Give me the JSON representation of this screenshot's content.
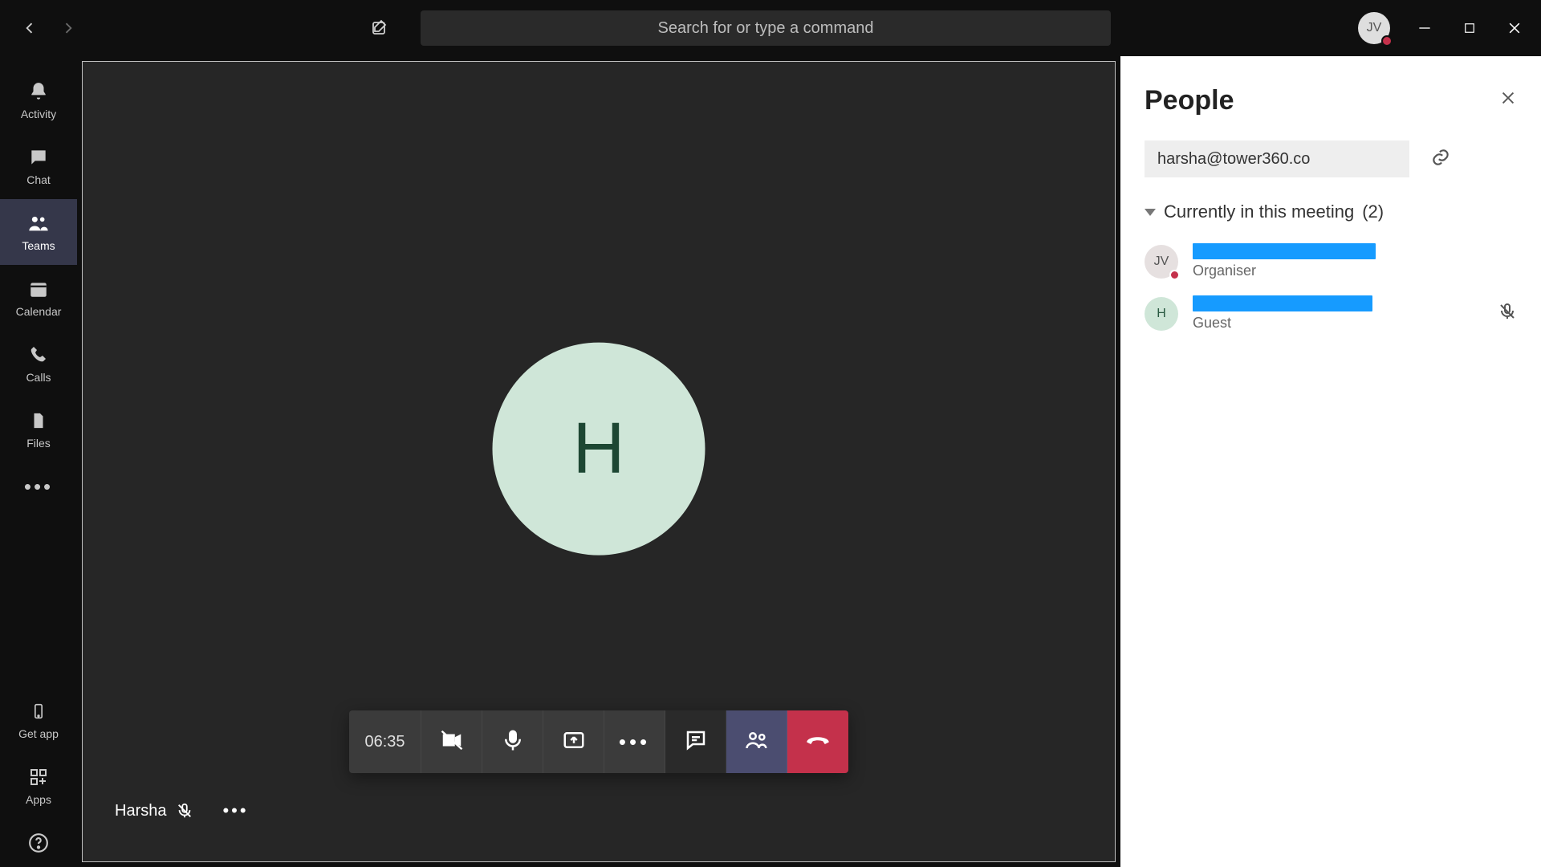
{
  "titlebar": {
    "search_placeholder": "Search for or type a command",
    "avatar_initials": "JV"
  },
  "rail": {
    "items": [
      {
        "id": "activity",
        "label": "Activity"
      },
      {
        "id": "chat",
        "label": "Chat"
      },
      {
        "id": "teams",
        "label": "Teams",
        "active": true
      },
      {
        "id": "calendar",
        "label": "Calendar"
      },
      {
        "id": "calls",
        "label": "Calls"
      },
      {
        "id": "files",
        "label": "Files"
      }
    ],
    "getapp_label": "Get app",
    "apps_label": "Apps"
  },
  "stage": {
    "big_avatar_initial": "H",
    "participant_name": "Harsha"
  },
  "callbar": {
    "timer": "06:35"
  },
  "people": {
    "title": "People",
    "invite_value": "harsha@tower360.co",
    "section_label": "Currently in this meeting",
    "section_count": "(2)",
    "participants": [
      {
        "avatar": "JV",
        "avatar_class": "jv",
        "redact_w": 228,
        "role": "Organiser",
        "presence": true,
        "muted": false
      },
      {
        "avatar": "H",
        "avatar_class": "h",
        "redact_w": 224,
        "role": "Guest",
        "presence": false,
        "muted": true
      }
    ]
  }
}
